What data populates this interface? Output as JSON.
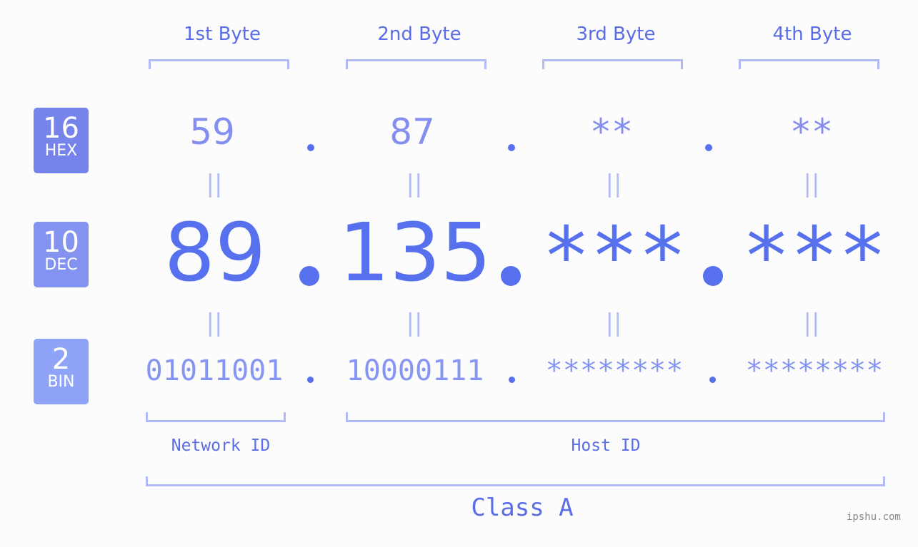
{
  "byte_headers": [
    "1st Byte",
    "2nd Byte",
    "3rd Byte",
    "4th Byte"
  ],
  "badges": {
    "hex": {
      "number": "16",
      "label": "HEX",
      "color": "#7583ea"
    },
    "dec": {
      "number": "10",
      "label": "DEC",
      "color": "#8593f0"
    },
    "bin": {
      "number": "2",
      "label": "BIN",
      "color": "#8fa4f7"
    }
  },
  "hex_values": [
    "59",
    "87",
    "**",
    "**"
  ],
  "dec_values": [
    "89",
    "135",
    "***",
    "***"
  ],
  "bin_values": [
    "01011001",
    "10000111",
    "********",
    "********"
  ],
  "equals_symbol": "||",
  "segments": {
    "network": "Network ID",
    "host": "Host ID",
    "class": "Class A"
  },
  "watermark": "ipshu.com",
  "colors": {
    "accent": "#5670ee",
    "bracket": "#b1baf6",
    "background": "#fbfcfb"
  }
}
